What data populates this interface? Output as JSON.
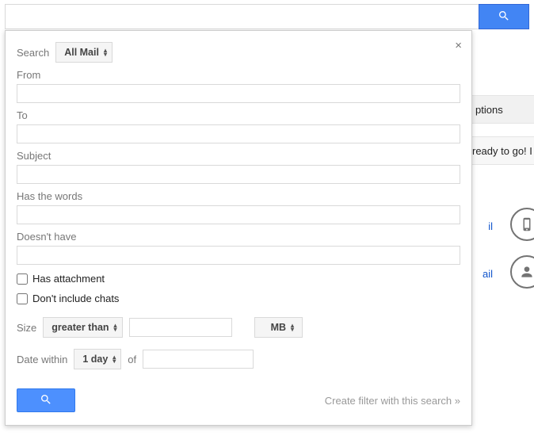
{
  "searchbar": {
    "value": ""
  },
  "panel": {
    "search_label": "Search",
    "scope_selected": "All Mail",
    "from_label": "From",
    "from_value": "",
    "to_label": "To",
    "to_value": "",
    "subject_label": "Subject",
    "subject_value": "",
    "haswords_label": "Has the words",
    "haswords_value": "",
    "doesnthave_label": "Doesn't have",
    "doesnthave_value": "",
    "has_attachment_label": "Has attachment",
    "dont_include_chats_label": "Don't include chats",
    "size_label": "Size",
    "size_op_selected": "greater than",
    "size_value": "",
    "size_unit_selected": "MB",
    "date_within_label": "Date within",
    "date_range_selected": "1 day",
    "of_label": "of",
    "date_value": "",
    "create_filter_label": "Create filter with this search »"
  },
  "background": {
    "options_text": "ptions",
    "ready_text": "ready to go! I",
    "link1_text": "il",
    "link2_text": "ail"
  }
}
